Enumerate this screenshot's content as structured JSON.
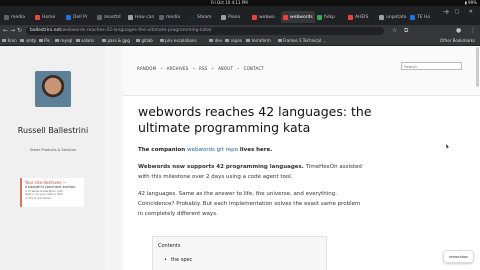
{
  "topbar": {
    "clock": "Fri Oct 10   4:11 PM",
    "battery": "99%"
  },
  "tabs": [
    {
      "label": "media",
      "color": "#5f6368"
    },
    {
      "label": "Home",
      "color": "#e8453c"
    },
    {
      "label": "Dell Pr",
      "color": "#1a73e8"
    },
    {
      "label": "zeasttd",
      "color": "#5f6368"
    },
    {
      "label": "How can",
      "color": "#9aa0a6"
    },
    {
      "label": "media",
      "color": "#5f6368"
    },
    {
      "label": "Steam",
      "color": "#1b2838"
    },
    {
      "label": "Piano",
      "color": "#9aa0a6"
    },
    {
      "label": "webwo",
      "color": "#ea4335"
    },
    {
      "label": "webwords",
      "color": "#ea4335",
      "active": true
    },
    {
      "label": "fvlkp",
      "color": "#34a853"
    },
    {
      "label": "AHElS",
      "color": "#ea4335"
    },
    {
      "label": "unpotato",
      "color": "#9aa0a6"
    },
    {
      "label": "TE Ho",
      "color": "#1a73e8"
    }
  ],
  "toolbar": {
    "url_host": "ballestrini.net",
    "url_path": "/webwords-reaches-42-languages-the-ultimate-programming-kata/"
  },
  "bookmarks": [
    "Kron",
    "smtp",
    "Pis",
    "mysql",
    "solaris",
    "pass & gpg",
    "gitlab",
    "priv escalations",
    "dev",
    "repos",
    "terraform",
    "Frames 3 Technical ..."
  ],
  "bookmarks_other": "Other Bookmarks",
  "sidebar": {
    "author": "Russell Ballestrini",
    "tagline": "Green Products & Services",
    "promo_l1": "Your site deserves —",
    "promo_l2": "a beautiful comment section.",
    "promo_l3a": "1 of www.remarkbox.com",
    "promo_l3b": "Demo on your site in 30s",
    "promo_l3c": "or try it out here!"
  },
  "nav": [
    "RANDOM",
    "ARCHIVES",
    "RSS",
    "ABOUT",
    "CONTACT"
  ],
  "search_placeholder": "Search",
  "article": {
    "title": "webwords reaches 42 languages: the ultimate programming kata",
    "p1_pre": "The companion ",
    "p1_link": "webwords git repo",
    "p1_post": " lives here.",
    "p2_strong": "Webwords now supports 42 programming languages.",
    "p2_rest": " TimeHexOn assisted with this milestone over 2 days using a code agent tool.",
    "p3": "42 languages. Same as the answer to life, the universe, and everything. Coincidence? Probably. But each implementation solves the exact same problem in completely different ways.",
    "toc_heading": "Contents",
    "toc_item1": "the spec"
  },
  "widget_label": "remarkbox"
}
